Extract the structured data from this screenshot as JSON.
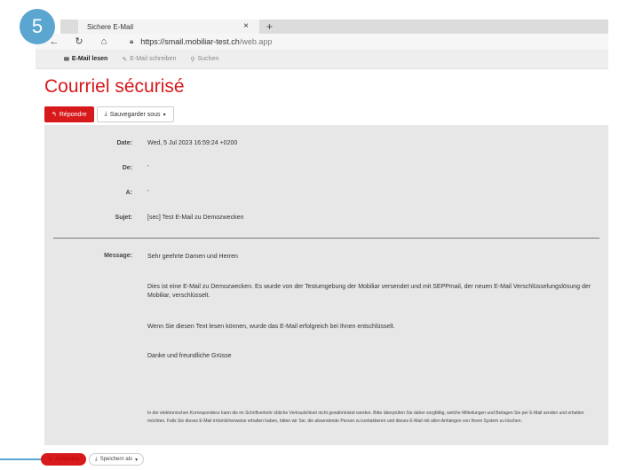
{
  "step": {
    "number": "5"
  },
  "browser": {
    "tab_title": "Sichere E-Mail",
    "tab_close": "×",
    "new_tab": "+",
    "url_host": "https://smail.mobiliar-test.ch",
    "url_path": "/web.app"
  },
  "app_nav": {
    "items": [
      {
        "label": "E-Mail lesen",
        "icon": "envelope-icon",
        "active": true
      },
      {
        "label": "E-Mail schreiben",
        "icon": "pencil-icon",
        "active": false
      },
      {
        "label": "Suchen",
        "icon": "search-icon",
        "active": false
      }
    ]
  },
  "page": {
    "title": "Courriel sécurisé"
  },
  "toolbar": {
    "reply_label": "Répondre",
    "save_label": "Sauvegarder sous",
    "save_caret": "▾"
  },
  "email": {
    "date_label": "Date:",
    "date_value": "Wed, 5 Jul 2023 16:59:24 +0200",
    "from_label": "De:",
    "from_value": "'",
    "to_label": "A:",
    "to_value": "'",
    "subject_label": "Sujet:",
    "subject_value": "[sec] Test E-Mail zu Demozwecken",
    "message_label": "Message:",
    "paragraphs": [
      "Sehr geehrte Damen und Herren",
      "Dies ist eine E-Mail zu Demozwecken. Es wurde von der Testumgebung der Mobiliar versendet und mit SEPPmail, der neuen E-Mail Verschlüsselungslösung der Mobiliar, verschlüsselt.",
      "Wenn Sie diesen Text lesen können, wurde das E-Mail erfolgreich bei Ihnen entschlüsselt.",
      "Danke und freundliche Grüsse"
    ],
    "footer": "In der elektronischen Korrespondenz kann die im Schriftverkehr übliche Vertraulichkeit nicht gewährleistet werden. Bitte überprüfen Sie daher sorgfältig, welche Mitteilungen und Beilagen Sie per E-Mail senden und erhalten möchten. Falls Sie dieses E-Mail irrtümlicherweise erhalten haben, bitten wir Sie, die absendende Person zu kontaktieren und dieses E-Mail mit allen Anhängen von Ihrem System zu löschen."
  },
  "bottom_bar": {
    "reply_label": "Antworten",
    "save_label": "Speichern als",
    "save_caret": "▾"
  },
  "colors": {
    "accent": "#d7191c",
    "step_badge": "#5aa6d0",
    "panel": "#e7e7e7"
  }
}
